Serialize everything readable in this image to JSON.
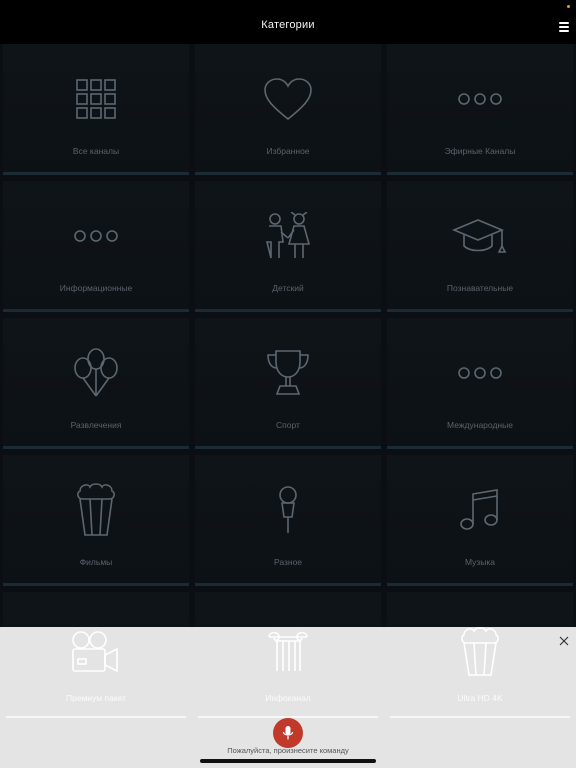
{
  "header": {
    "title": "Категории"
  },
  "categories": [
    {
      "label": "Все каналы",
      "icon": "grid-icon"
    },
    {
      "label": "Избранное",
      "icon": "heart-icon"
    },
    {
      "label": "Эфирные Каналы",
      "icon": "dots-icon"
    },
    {
      "label": "Информационные",
      "icon": "dots-icon"
    },
    {
      "label": "Детский",
      "icon": "children-icon"
    },
    {
      "label": "Познавательные",
      "icon": "graduation-cap-icon"
    },
    {
      "label": "Развлечения",
      "icon": "balloons-icon"
    },
    {
      "label": "Спорт",
      "icon": "trophy-icon"
    },
    {
      "label": "Международные",
      "icon": "dots-icon"
    },
    {
      "label": "Фильмы",
      "icon": "popcorn-icon"
    },
    {
      "label": "Разное",
      "icon": "microphone-icon"
    },
    {
      "label": "Музыка",
      "icon": "music-note-icon"
    }
  ],
  "sheet": {
    "tiles": [
      {
        "label": "Премиум пакет",
        "icon": "movie-camera-icon"
      },
      {
        "label": "Инфоканал",
        "icon": "column-icon"
      },
      {
        "label": "Ultra HD 4K",
        "icon": "popcorn-icon"
      }
    ],
    "prompt": "Пожалуйста, произнесите команду"
  },
  "colors": {
    "accent": "#c0392b",
    "background": "#0b0f13",
    "notification": "#ff9500"
  }
}
